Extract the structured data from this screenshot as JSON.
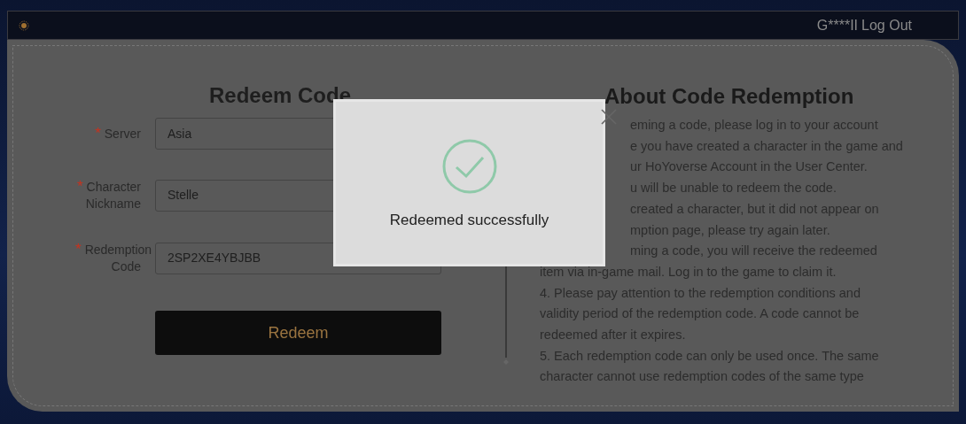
{
  "header": {
    "user": "G****II",
    "logout": "Log Out"
  },
  "form": {
    "title": "Redeem Code",
    "fields": [
      {
        "marker": "*",
        "label": "Server",
        "value": "Asia"
      },
      {
        "marker": "*",
        "label": "Character Nickname",
        "value": "Stelle"
      },
      {
        "marker": "*",
        "label": "Redemption Code",
        "value": "2SP2XE4YBJBB"
      }
    ],
    "submit": "Redeem"
  },
  "about": {
    "title": "About Code Redemption",
    "lines": [
      {
        "text": "eming a code, please log in to your account",
        "kind": "partial"
      },
      {
        "text": "e you have created a character in the game and",
        "kind": "partial"
      },
      {
        "text": "ur HoYoverse Account in the User Center.",
        "kind": "partial"
      },
      {
        "text": "u will be unable to redeem the code.",
        "kind": "partial"
      },
      {
        "text": "created a character, but it did not appear on",
        "kind": "partial"
      },
      {
        "text": "mption page, please try again later.",
        "kind": "partial"
      },
      {
        "text": "ming a code, you will receive the redeemed",
        "kind": "partial"
      },
      {
        "text": "item via in-game mail. Log in to the game to claim it.",
        "kind": "full"
      },
      {
        "text": "4. Please pay attention to the redemption conditions and",
        "kind": "full"
      },
      {
        "text": "validity period of the redemption code. A code cannot be",
        "kind": "full"
      },
      {
        "text": "redeemed after it expires.",
        "kind": "full"
      },
      {
        "text": "5. Each redemption code can only be used once. The same",
        "kind": "full"
      },
      {
        "text": "character cannot use redemption codes of the same type",
        "kind": "full"
      }
    ]
  },
  "dialog": {
    "message": "Redeemed successfully"
  }
}
